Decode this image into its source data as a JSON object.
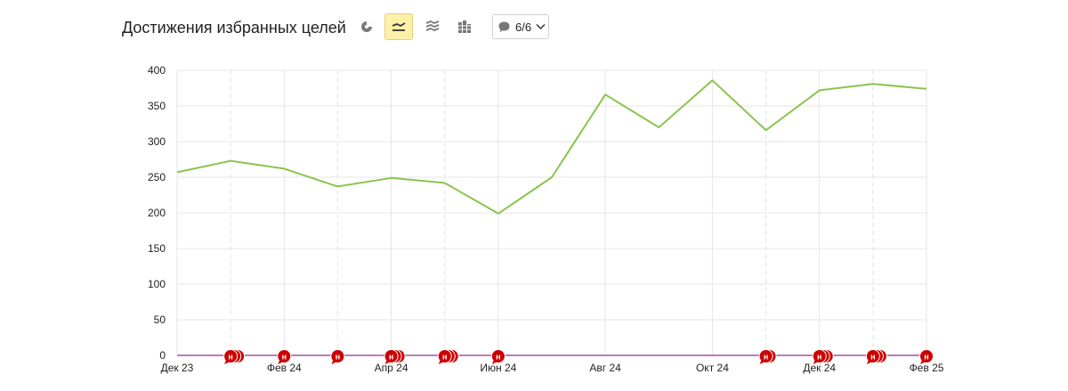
{
  "header": {
    "title": "Достижения избранных целей",
    "buttons": [
      {
        "icon": "pie-chart-icon",
        "active": false
      },
      {
        "icon": "line-chart-icon",
        "active": true
      },
      {
        "icon": "area-chart-icon",
        "active": false
      },
      {
        "icon": "bar-chart-icon",
        "active": false
      }
    ],
    "notes_count": "6/6",
    "accent_active": "#fff0a8"
  },
  "chart_data": {
    "type": "line",
    "x": [
      "Дек 23",
      "Янв 24",
      "Фев 24",
      "Мар 24",
      "Апр 24",
      "Май 24",
      "Июн 24",
      "Июл 24",
      "Авг 24",
      "Сен 24",
      "Окт 24",
      "Ноя 24",
      "Дек 24",
      "Янв 25",
      "Фев 25"
    ],
    "x_tick_labels": [
      "Дек 23",
      "Фев 24",
      "Апр 24",
      "Июн 24",
      "Авг 24",
      "Окт 24",
      "Дек 24",
      "Фев 25"
    ],
    "series": [
      {
        "values": [
          257,
          273,
          262,
          237,
          249,
          242,
          199,
          250,
          366,
          320,
          386,
          316,
          372,
          381,
          374
        ],
        "color": "#8ac44e"
      }
    ],
    "ylim": [
      0,
      400
    ],
    "y_ticks": [
      0,
      50,
      100,
      150,
      200,
      250,
      300,
      350,
      400
    ],
    "grid": true,
    "baseline_color": "#a64fb0",
    "annotation_marker": {
      "label": "н",
      "color": "#cc0000"
    },
    "annotations": [
      {
        "x": "Янв 24",
        "count": 3
      },
      {
        "x": "Фев 24",
        "count": 1
      },
      {
        "x": "Мар 24",
        "count": 1
      },
      {
        "x": "Апр 24",
        "count": 3
      },
      {
        "x": "Май 24",
        "count": 3
      },
      {
        "x": "Июн 24",
        "count": 1
      },
      {
        "x": "Ноя 24",
        "count": 2
      },
      {
        "x": "Дек 24",
        "count": 3
      },
      {
        "x": "Янв 25",
        "count": 3
      },
      {
        "x": "Фев 25",
        "count": 1
      }
    ],
    "dashed_x": [
      "Янв 24",
      "Мар 24",
      "Апр 24",
      "Май 24",
      "Ноя 24",
      "Янв 25"
    ]
  }
}
